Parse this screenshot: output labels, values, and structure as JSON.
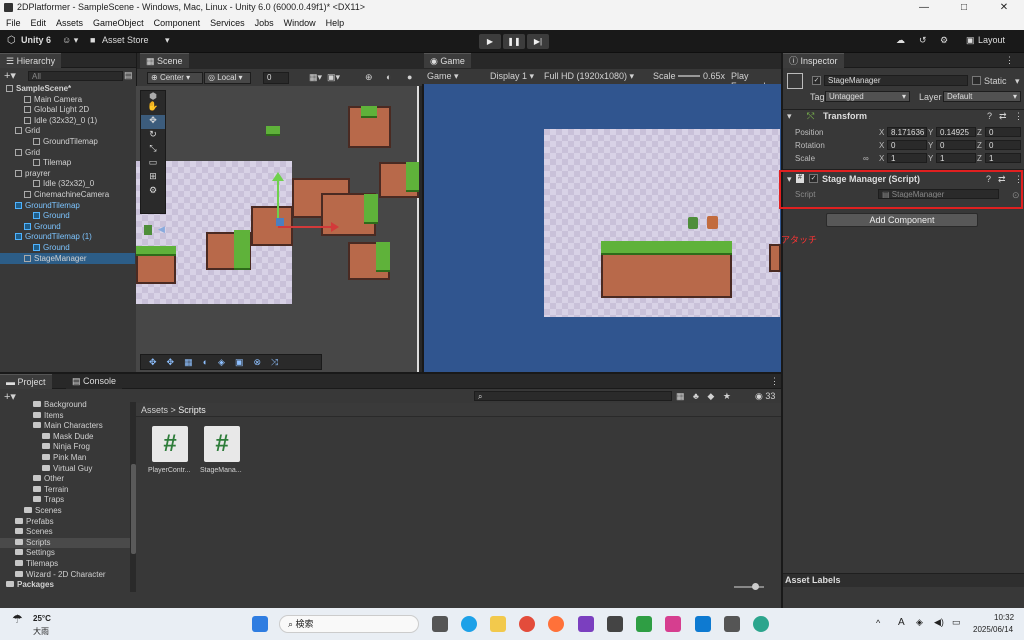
{
  "window": {
    "title": "2DPlatformer - SampleScene - Windows, Mac, Linux - Unity 6.0 (6000.0.49f1)* <DX11>",
    "controls": [
      "—",
      "□",
      "✕"
    ]
  },
  "menu": [
    "File",
    "Edit",
    "Assets",
    "GameObject",
    "Component",
    "Services",
    "Jobs",
    "Window",
    "Help"
  ],
  "toolbar": {
    "account": "Unity 6",
    "asset_store": "Asset Store",
    "layout": "Layout"
  },
  "hierarchy": {
    "tab": "Hierarchy",
    "search_placeholder": "All",
    "items": [
      {
        "label": "SampleScene*",
        "indent": 0,
        "bold": true
      },
      {
        "label": "Main Camera",
        "indent": 2
      },
      {
        "label": "Global Light 2D",
        "indent": 2
      },
      {
        "label": "Idle (32x32)_0 (1)",
        "indent": 2
      },
      {
        "label": "Grid",
        "indent": 1
      },
      {
        "label": "GroundTilemap",
        "indent": 3
      },
      {
        "label": "Grid",
        "indent": 1
      },
      {
        "label": "Tilemap",
        "indent": 3
      },
      {
        "label": "prayrer",
        "indent": 1
      },
      {
        "label": "Idle (32x32)_0",
        "indent": 3
      },
      {
        "label": "CinemachineCamera",
        "indent": 2
      },
      {
        "label": "GroundTilemap",
        "indent": 1,
        "blue": true
      },
      {
        "label": "Ground",
        "indent": 3,
        "blue": true
      },
      {
        "label": "Ground",
        "indent": 2,
        "blue": true
      },
      {
        "label": "GroundTilemap (1)",
        "indent": 1,
        "blue": true
      },
      {
        "label": "Ground",
        "indent": 3,
        "blue": true
      },
      {
        "label": "StageManager",
        "indent": 2,
        "selected": true
      }
    ]
  },
  "scene": {
    "tab": "Scene",
    "pivot": "Center",
    "space": "Local",
    "snap": "0"
  },
  "game": {
    "tab": "Game",
    "mode": "Game",
    "display": "Display 1",
    "resolution": "Full HD (1920x1080)",
    "scale_label": "Scale",
    "scale": "0.65x",
    "play_focused": "Play Focused"
  },
  "inspector": {
    "tab": "Inspector",
    "object_name": "StageManager",
    "static": "Static",
    "tag_label": "Tag",
    "tag": "Untagged",
    "layer_label": "Layer",
    "layer": "Default",
    "transform": {
      "title": "Transform",
      "position_label": "Position",
      "rotation_label": "Rotation",
      "scale_label": "Scale",
      "position": {
        "x": "8.171636",
        "y": "0.14925",
        "z": "0"
      },
      "rotation": {
        "x": "0",
        "y": "0",
        "z": "0"
      },
      "scale": {
        "x": "1",
        "y": "1",
        "z": "1"
      }
    },
    "component": {
      "title": "Stage Manager (Script)",
      "script_label": "Script",
      "script": "StageManager"
    },
    "add_component": "Add Component",
    "annotation": "アタッチ",
    "asset_labels": "Asset Labels"
  },
  "project": {
    "tab": "Project",
    "console_tab": "Console",
    "breadcrumb_root": "Assets",
    "breadcrumb_current": "Scripts",
    "count": "33",
    "tree": [
      {
        "label": "Background",
        "indent": 3
      },
      {
        "label": "Items",
        "indent": 3
      },
      {
        "label": "Main Characters",
        "indent": 3
      },
      {
        "label": "Mask Dude",
        "indent": 4
      },
      {
        "label": "Ninja Frog",
        "indent": 4
      },
      {
        "label": "Pink Man",
        "indent": 4
      },
      {
        "label": "Virtual Guy",
        "indent": 4
      },
      {
        "label": "Other",
        "indent": 3
      },
      {
        "label": "Terrain",
        "indent": 3
      },
      {
        "label": "Traps",
        "indent": 3
      },
      {
        "label": "Scenes",
        "indent": 2
      },
      {
        "label": "Prefabs",
        "indent": 1
      },
      {
        "label": "Scenes",
        "indent": 1
      },
      {
        "label": "Scripts",
        "indent": 1,
        "selected": true
      },
      {
        "label": "Settings",
        "indent": 1
      },
      {
        "label": "Tilemaps",
        "indent": 1
      },
      {
        "label": "Wizard - 2D Character",
        "indent": 1
      },
      {
        "label": "Packages",
        "indent": 0,
        "bold": true
      }
    ],
    "files": [
      "PlayerContr...",
      "StageMana..."
    ]
  },
  "taskbar": {
    "temperature": "25°C",
    "weather": "大雨",
    "search": "検索",
    "time": "10:32",
    "date": "2025/06/14",
    "ime": "A"
  },
  "colors": {
    "selection": "#2c5d87",
    "highlight_box": "#e02020",
    "annotation": "#ff3333",
    "game_bg": "#30558f"
  }
}
